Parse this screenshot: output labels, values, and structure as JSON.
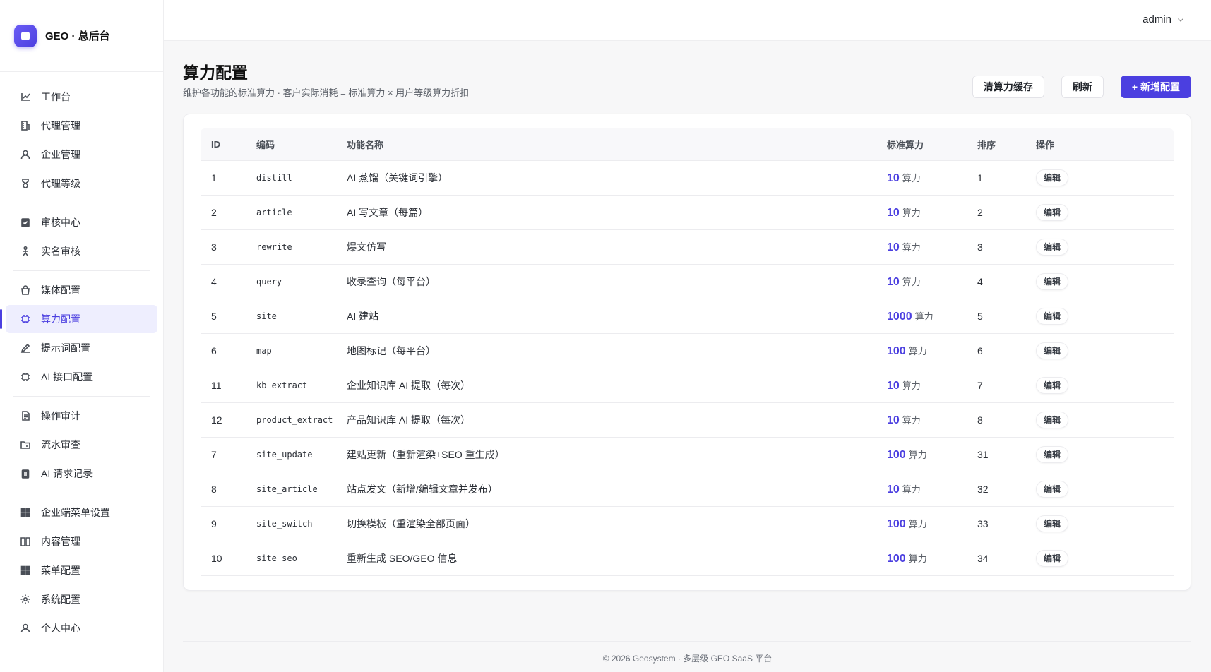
{
  "brand": {
    "title": "GEO · 总后台"
  },
  "header": {
    "user": "admin"
  },
  "sidebar": {
    "groups": [
      [
        {
          "label": "工作台",
          "icon": "chart-icon"
        },
        {
          "label": "代理管理",
          "icon": "building-icon"
        },
        {
          "label": "企业管理",
          "icon": "user-icon"
        },
        {
          "label": "代理等级",
          "icon": "medal-icon"
        }
      ],
      [
        {
          "label": "审核中心",
          "icon": "clipboard-check-icon"
        },
        {
          "label": "实名审核",
          "icon": "person-icon"
        }
      ],
      [
        {
          "label": "媒体配置",
          "icon": "bag-icon"
        },
        {
          "label": "算力配置",
          "icon": "chip-icon",
          "active": true
        },
        {
          "label": "提示词配置",
          "icon": "pen-icon"
        },
        {
          "label": "AI 接口配置",
          "icon": "chip-icon"
        }
      ],
      [
        {
          "label": "操作审计",
          "icon": "document-icon"
        },
        {
          "label": "流水审查",
          "icon": "folder-icon"
        },
        {
          "label": "AI 请求记录",
          "icon": "clipboard-icon"
        }
      ],
      [
        {
          "label": "企业端菜单设置",
          "icon": "grid-icon"
        },
        {
          "label": "内容管理",
          "icon": "book-icon"
        },
        {
          "label": "菜单配置",
          "icon": "grid-icon"
        },
        {
          "label": "系统配置",
          "icon": "gear-icon"
        },
        {
          "label": "个人中心",
          "icon": "user-icon"
        }
      ]
    ]
  },
  "page": {
    "title": "算力配置",
    "subtitle": "维护各功能的标准算力 · 客户实际消耗 = 标准算力 × 用户等级算力折扣",
    "buttons": {
      "clear_cache": "清算力缓存",
      "refresh": "刷新",
      "add": "+ 新增配置"
    }
  },
  "table": {
    "columns": [
      "ID",
      "编码",
      "功能名称",
      "标准算力",
      "排序",
      "操作"
    ],
    "unit": "算力",
    "edit_label": "编辑",
    "rows": [
      {
        "id": "1",
        "code": "distill",
        "name": "AI 蒸馏（关键词引擎）",
        "power": "10",
        "sort": "1"
      },
      {
        "id": "2",
        "code": "article",
        "name": "AI 写文章（每篇）",
        "power": "10",
        "sort": "2"
      },
      {
        "id": "3",
        "code": "rewrite",
        "name": "爆文仿写",
        "power": "10",
        "sort": "3"
      },
      {
        "id": "4",
        "code": "query",
        "name": "收录查询（每平台）",
        "power": "10",
        "sort": "4"
      },
      {
        "id": "5",
        "code": "site",
        "name": "AI 建站",
        "power": "1000",
        "sort": "5"
      },
      {
        "id": "6",
        "code": "map",
        "name": "地图标记（每平台）",
        "power": "100",
        "sort": "6"
      },
      {
        "id": "11",
        "code": "kb_extract",
        "name": "企业知识库 AI 提取（每次）",
        "power": "10",
        "sort": "7"
      },
      {
        "id": "12",
        "code": "product_extract",
        "name": "产品知识库 AI 提取（每次）",
        "power": "10",
        "sort": "8"
      },
      {
        "id": "7",
        "code": "site_update",
        "name": "建站更新（重新渲染+SEO 重生成）",
        "power": "100",
        "sort": "31"
      },
      {
        "id": "8",
        "code": "site_article",
        "name": "站点发文（新增/编辑文章并发布）",
        "power": "10",
        "sort": "32"
      },
      {
        "id": "9",
        "code": "site_switch",
        "name": "切换模板（重渲染全部页面）",
        "power": "100",
        "sort": "33"
      },
      {
        "id": "10",
        "code": "site_seo",
        "name": "重新生成 SEO/GEO 信息",
        "power": "100",
        "sort": "34"
      }
    ]
  },
  "footer": "© 2026 Geosystem · 多层级 GEO SaaS 平台",
  "colors": {
    "accent": "#4b3fe0",
    "active_bg": "#eeeefe"
  }
}
